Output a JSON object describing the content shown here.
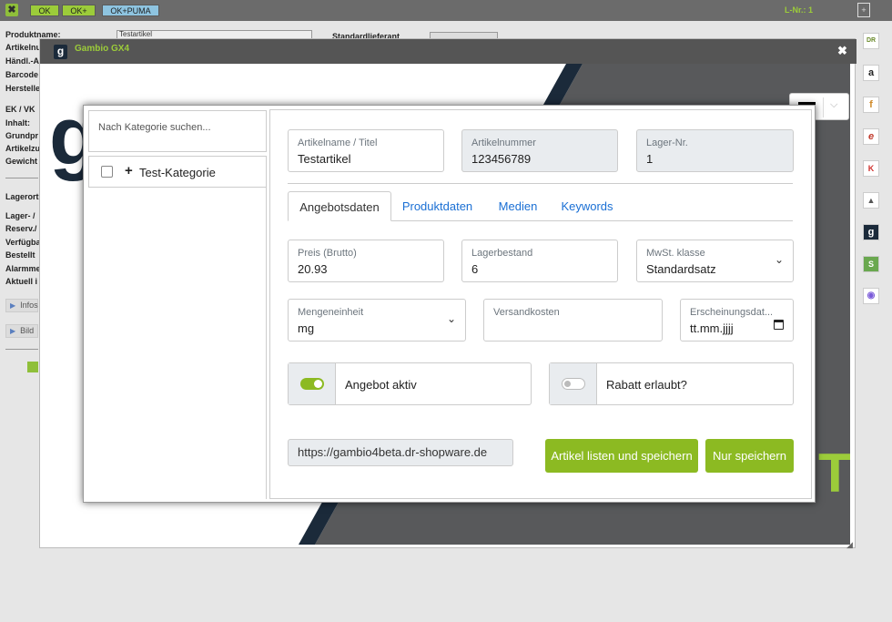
{
  "toolbar": {
    "buttons": [
      "OK",
      "OK+",
      "OK+PUMA"
    ],
    "lnr": "L-Nr.: 1"
  },
  "bgform": {
    "labels": [
      "Produktname:",
      "Artikelnu",
      "Händl.-A",
      "Barcode",
      "Herstelle",
      "EK / VK",
      "Inhalt:",
      "Grundpr",
      "Artikelzu",
      "Gewicht",
      "Lagerort",
      "Lager- / ",
      "Reserv./",
      "Verfügba",
      "Bestellt",
      "Alarmme",
      "Aktuell i"
    ],
    "product_value": "Testartikel",
    "supplier_label": "Standardlieferant",
    "infos": "Infos",
    "bild": "Bild"
  },
  "right_icons": [
    "DR",
    "a",
    "f",
    "e",
    "K",
    "▲",
    "g",
    "S",
    "◉"
  ],
  "gambio": {
    "title": "Gambio GX4",
    "logo": "g",
    "close": "✖"
  },
  "language": {
    "flag_colors": [
      "#000000",
      "#dd0000",
      "#ffcc00"
    ]
  },
  "category": {
    "search_placeholder": "Nach Kategorie suchen...",
    "item": "Test-Kategorie"
  },
  "form": {
    "name_label": "Artikelname / Titel",
    "name_value": "Testartikel",
    "artnr_label": "Artikelnummer",
    "artnr_value": "123456789",
    "lager_label": "Lager-Nr.",
    "lager_value": "1"
  },
  "tabs": [
    "Angebotsdaten",
    "Produktdaten",
    "Medien",
    "Keywords"
  ],
  "offer": {
    "price_label": "Preis (Brutto)",
    "price_value": "20.93",
    "stock_label": "Lagerbestand",
    "stock_value": "6",
    "vat_label": "MwSt. klasse",
    "vat_value": "Standardsatz",
    "unit_label": "Mengeneinheit",
    "unit_value": "mg",
    "shipping_label": "Versandkosten",
    "shipping_value": "",
    "release_label": "Erscheinungsdat...",
    "release_placeholder": "tt.mm.jjjj",
    "active_label": "Angebot aktiv",
    "active_on": true,
    "discount_label": "Rabatt erlaubt?",
    "discount_on": false
  },
  "footer": {
    "url": "https://gambio4beta.dr-shopware.de",
    "list_save": "Artikel listen und speichern",
    "save": "Nur speichern"
  },
  "colors": {
    "green": "#8cba22",
    "dark": "#1b2a3a",
    "header": "#555555"
  }
}
